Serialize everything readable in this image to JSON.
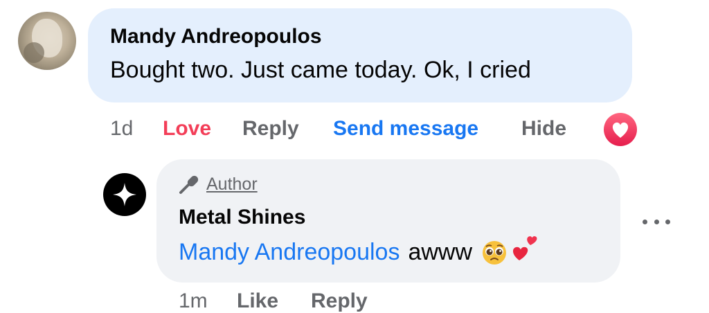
{
  "comment": {
    "author": "Mandy Andreopoulos",
    "text": "Bought two. Just came today. Ok, I cried",
    "time": "1d",
    "actions": {
      "love": "Love",
      "reply": "Reply",
      "send_message": "Send message",
      "hide": "Hide"
    },
    "reaction_icon": "heart-icon"
  },
  "reply": {
    "badge_icon": "microphone-icon",
    "badge_label": "Author",
    "author": "Metal Shines",
    "mention": "Mandy Andreopoulos",
    "text": "awww",
    "emojis": [
      "pleading-face-emoji",
      "two-hearts-emoji"
    ],
    "time": "1m",
    "actions": {
      "like": "Like",
      "reply": "Reply"
    },
    "more_icon": "more-options-icon"
  },
  "colors": {
    "comment_bubble": "#e4effd",
    "reply_bubble": "#f0f2f5",
    "love": "#f33e58",
    "link_blue": "#1877f2",
    "muted": "#65676b"
  }
}
